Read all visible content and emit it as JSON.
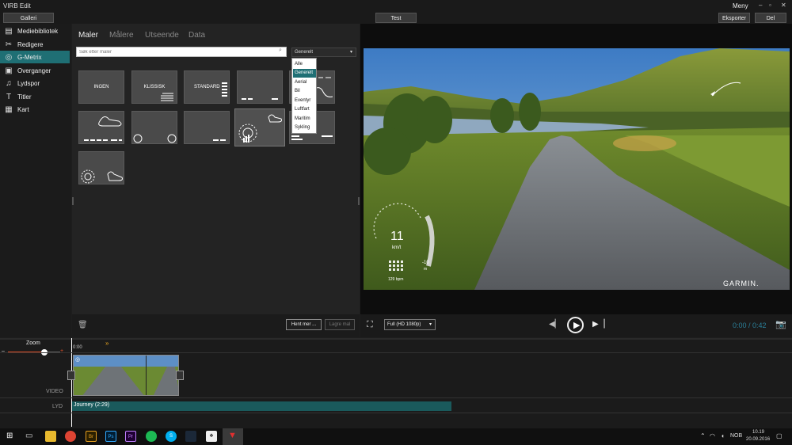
{
  "window": {
    "title": "VIRB Edit",
    "menu": "Meny",
    "controls": [
      "–",
      "▫",
      "✕"
    ]
  },
  "toolbar": {
    "gallery": "Galleri",
    "project": "Test",
    "export": "Eksporter",
    "share": "Del"
  },
  "sidebar": {
    "items": [
      {
        "label": "Mediebibliotek",
        "icon": "film-icon",
        "glyph": "▤"
      },
      {
        "label": "Redigere",
        "icon": "scissors-icon",
        "glyph": "✂"
      },
      {
        "label": "G-Metrix",
        "icon": "gmetrix-icon",
        "glyph": "◎",
        "active": true
      },
      {
        "label": "Overganger",
        "icon": "transition-icon",
        "glyph": "▣"
      },
      {
        "label": "Lydspor",
        "icon": "music-icon",
        "glyph": "♫"
      },
      {
        "label": "Titler",
        "icon": "title-icon",
        "glyph": "T"
      },
      {
        "label": "Kart",
        "icon": "map-icon",
        "glyph": "▦"
      }
    ]
  },
  "panel": {
    "tabs": [
      "Maler",
      "Målere",
      "Utseende",
      "Data"
    ],
    "search_placeholder": "Søk etter maler",
    "dropdown_value": "Generelt",
    "dropdown_options": [
      "Alle",
      "Generelt",
      "Aerial",
      "Bil",
      "Eventyr",
      "Luftfart",
      "Maritim",
      "Sykling"
    ],
    "tiles": [
      "INGEN",
      "KLISSISK",
      "STANDARD",
      "",
      "",
      "",
      "",
      "",
      "",
      "",
      "",
      ""
    ],
    "load_more": "Hent mer ...",
    "save_template": "Lagre mal"
  },
  "overlay": {
    "speed": "11",
    "speed_unit": "km/t",
    "grade": "-10",
    "grade_unit": "m",
    "cadence": "129 bpm",
    "brand": "GARMIN."
  },
  "controls": {
    "quality": "Full (HD 1080p)",
    "time": "0:00 / 0:42"
  },
  "timeline": {
    "zoom_label": "Zoom",
    "start_time": "0:00",
    "video_label": "VIDEO",
    "audio_label": "LYD",
    "audio_track": "Journey  (2:29)"
  },
  "taskbar": {
    "lang": "NOB",
    "time": "10.19",
    "date": "20.09.2016"
  },
  "colors": {
    "accent": "#1f6f74",
    "audio_clip": "#1a5a5c",
    "zoom_slider": "#e0502a"
  }
}
